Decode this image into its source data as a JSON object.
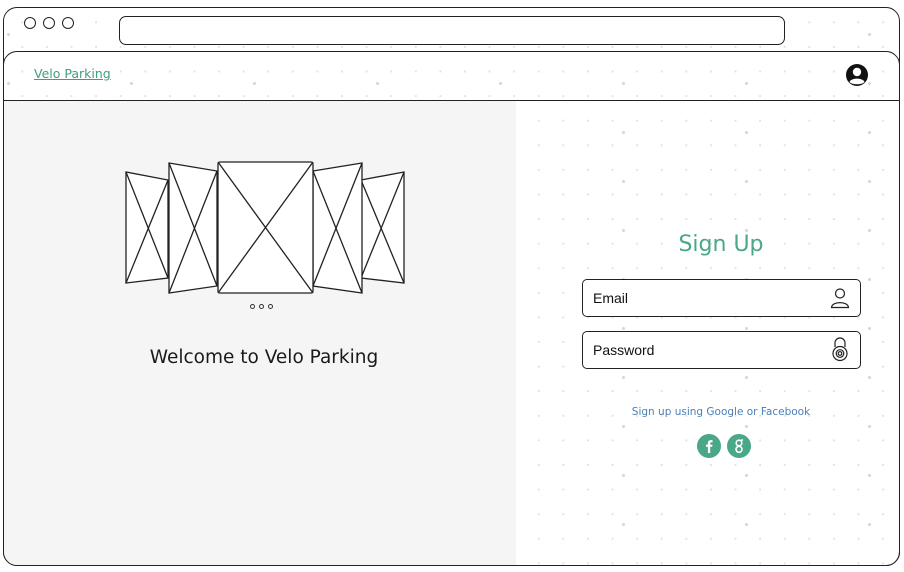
{
  "nav": {
    "brand": "Velo Parking"
  },
  "hero": {
    "welcome": "Welcome to Velo Parking"
  },
  "signup": {
    "title": "Sign Up",
    "email_placeholder": "Email",
    "password_placeholder": "Password",
    "social_text": "Sign up using Google or Facebook"
  },
  "colors": {
    "accent": "#4aa787",
    "link": "#4a7fb5",
    "panel_bg": "#f5f5f5"
  },
  "icons": [
    "user-outline-icon",
    "padlock-icon",
    "facebook-icon",
    "google-icon",
    "account-circle-icon"
  ]
}
